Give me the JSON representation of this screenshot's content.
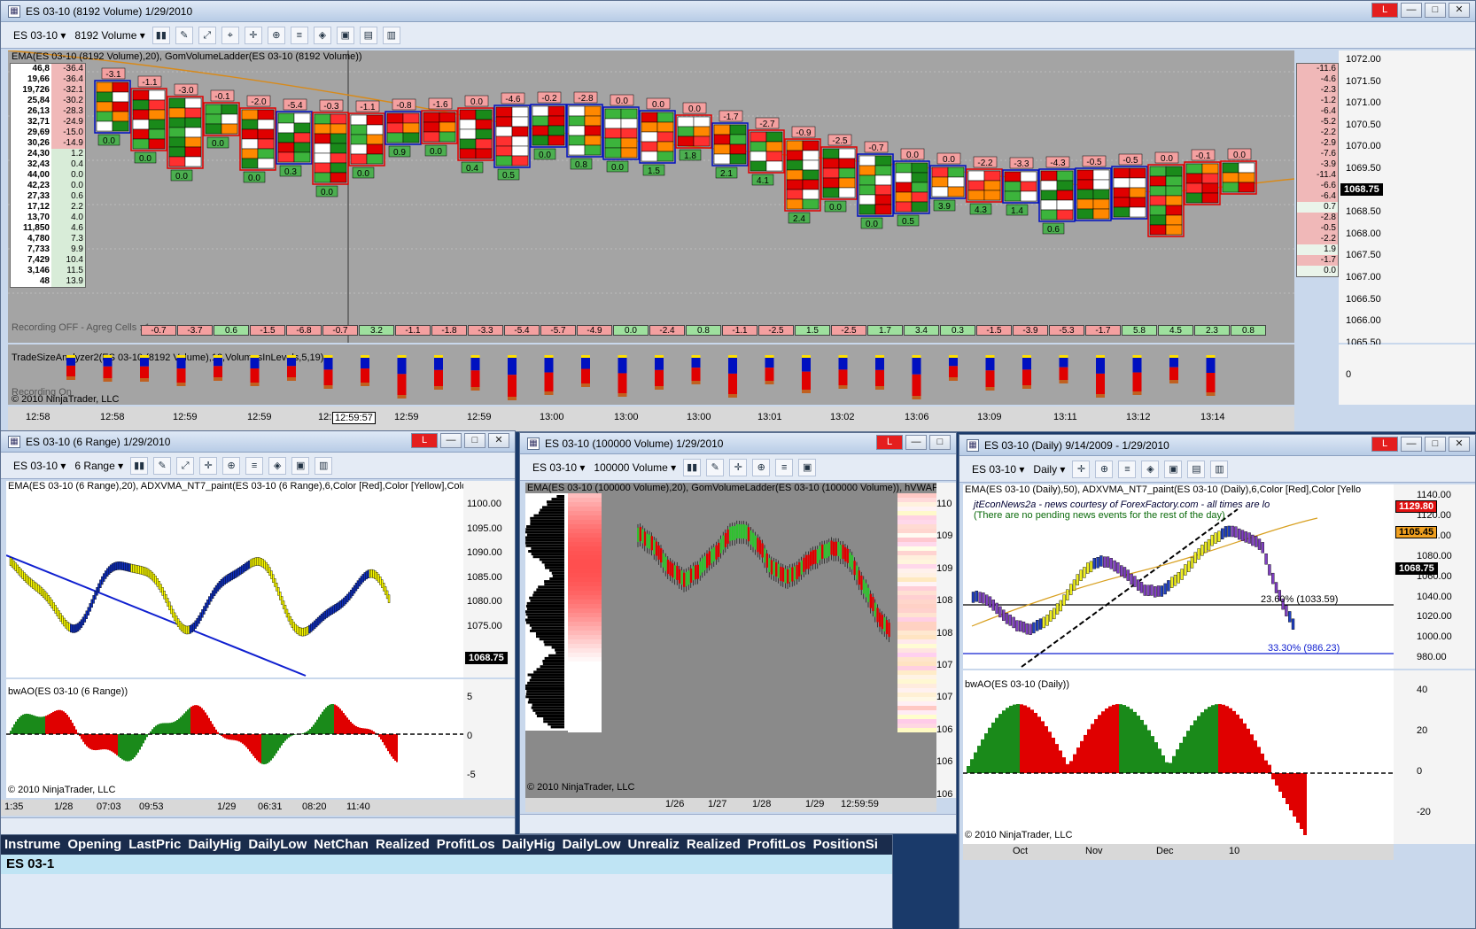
{
  "main": {
    "title": "ES 03-10 (8192 Volume)  1/29/2010",
    "instrument": "ES 03-10",
    "period": "8192 Volume",
    "indicator_caption": "EMA(ES 03-10 (8192 Volume),20), GomVolumeLadder(ES 03-10 (8192 Volume))",
    "recording_caption": "Recording OFF - Agreg Cells : 1",
    "tsa_caption": "TradeSizeAnalyzer2(ES 03-10 (8192 Volume),12,VolumesInLevels,5,19)",
    "recording_on": "Recording On",
    "copyright": "© 2010 NinjaTrader, LLC",
    "price_axis": [
      "1072.00",
      "1071.50",
      "1071.00",
      "1070.50",
      "1070.00",
      "1069.50",
      "1069.00",
      "1068.50",
      "1068.00",
      "1067.50",
      "1067.00",
      "1066.50",
      "1066.00",
      "1065.50"
    ],
    "current_price": "1068.75",
    "zero_label": "0",
    "time_axis": [
      "12:58",
      "12:58",
      "12:59",
      "12:59",
      "12:",
      "12:59:57",
      "12:59",
      "12:59",
      "13:00",
      "13:00",
      "13:00",
      "13:01",
      "13:02",
      "13:06",
      "13:09",
      "13:11",
      "13:12",
      "13:14"
    ],
    "left_volumes": [
      "46,8",
      "19,66",
      "19,726",
      "25,84",
      "26,13",
      "32,71",
      "29,69",
      "30,26",
      "24,30",
      "32,43",
      "44,00",
      "42,23",
      "27,33",
      "17,12",
      "13,70",
      "11,850",
      "4,780",
      "7,733",
      "7,429",
      "3,146",
      "48"
    ],
    "left_deltas": [
      "-36.4",
      "-36.4",
      "-32.1",
      "-30.2",
      "-28.3",
      "-24.9",
      "-15.0",
      "-14.9",
      "1.2",
      "0.4",
      "0.0",
      "0.0",
      "0.6",
      "2.2",
      "4.0",
      "4.6",
      "7.3",
      "9.9",
      "10.4",
      "11.5",
      "13.9"
    ],
    "right_deltas": [
      "-11.6",
      "-4.6",
      "-2.3",
      "-1.2",
      "-6.4",
      "-5.2",
      "-2.2",
      "-2.9",
      "-7.6",
      "-3.9",
      "-11.4",
      "-6.6",
      "-6.4",
      "0.7",
      "-2.8",
      "-0.5",
      "-2.2",
      "1.9",
      "-1.7",
      "0.0"
    ],
    "bottom_deltas": [
      "-0.7",
      "-3.7",
      "0.6",
      "-1.5",
      "-6.8",
      "-0.7",
      "3.2",
      "-1.1",
      "-1.8",
      "-3.3",
      "-5.4",
      "-5.7",
      "-4.9",
      "0.0",
      "-2.4",
      "0.8",
      "-1.1",
      "-2.5",
      "1.5",
      "-2.5",
      "1.7",
      "3.4",
      "0.3",
      "-1.5",
      "-3.9",
      "-5.3",
      "-1.7",
      "5.8",
      "4.5",
      "2.3",
      "0.8"
    ],
    "bar_deltas": [
      "-3.1",
      "-1.1",
      "-3.0",
      "-0.1",
      "-2.0",
      "-5.4",
      "-0.3",
      "-1.1",
      "-0.8",
      "-1.6",
      "0.0",
      "-4.6",
      "-0.2",
      "-2.8",
      "0.0",
      "0.0",
      "0.0",
      "-1.7",
      "-2.7",
      "-0.9",
      "-2.5",
      "-0.7",
      "0.0",
      "0.0",
      "-2.2",
      "-3.3",
      "-4.3",
      "-0.5",
      "-0.5",
      "0.0",
      "-0.1",
      "0.0"
    ],
    "bar_totals": [
      "0.0",
      "0.0",
      "0.0",
      "0.0",
      "0.0",
      "0.3",
      "0.0",
      "0.0",
      "0.9",
      "0.0",
      "0.4",
      "0.5",
      "0.0",
      "0.8",
      "0.0",
      "1.5",
      "1.8",
      "2.1",
      "4.1",
      "2.4",
      "0.0",
      "0.0",
      "0.5",
      "3.9",
      "4.3",
      "1.4",
      "0.6"
    ]
  },
  "range_win": {
    "title": "ES 03-10 (6 Range)  1/29/2010",
    "instrument": "ES 03-10",
    "period": "6 Range",
    "caption": "EMA(ES 03-10 (6 Range),20), ADXVMA_NT7_paint(ES 03-10 (6 Range),6,Color [Red],Color [Yellow],Color [Co",
    "ao_caption": "bwAO(ES 03-10 (6 Range))",
    "copyright": "© 2010 NinjaTrader, LLC",
    "price_axis": [
      "1100.00",
      "1095.00",
      "1090.00",
      "1085.00",
      "1080.00",
      "1075.00"
    ],
    "current_price": "1068.75",
    "ao_axis": [
      "5",
      "0",
      "-5"
    ],
    "time_axis": [
      "1:35",
      "1/28",
      "07:03",
      "09:53",
      "1/29",
      "06:31",
      "08:20",
      "11:40"
    ]
  },
  "vol_win": {
    "title": "ES 03-10 (100000 Volume)  1/29/2010",
    "instrument": "ES 03-10",
    "period": "100000 Volume",
    "caption": "EMA(ES 03-10 (100000 Volume),20), GomVolumeLadder(ES 03-10 (100000 Volume)), hVWAP(ES0",
    "copyright": "© 2010 NinjaTrader, LLC",
    "price_axis": [
      "110",
      "109",
      "109",
      "108",
      "108",
      "107",
      "107",
      "106",
      "106",
      "106"
    ],
    "time_axis": [
      "1/26",
      "1/27",
      "1/28",
      "1/29",
      "12:59:59"
    ]
  },
  "daily_win": {
    "title": "ES 03-10 (Daily)  9/14/2009 - 1/29/2010",
    "instrument": "ES 03-10",
    "period": "Daily",
    "caption": "EMA(ES 03-10 (Daily),50), ADXVMA_NT7_paint(ES 03-10 (Daily),6,Color [Red],Color [Yello",
    "news1": "jtEconNews2a - news courtesy of ForexFactory.com - all times are lo",
    "news2": "(There are no pending news events for the rest of the day)",
    "fib1": "23.60% (1033.59)",
    "fib2": "33.30% (986.23)",
    "ao_caption": "bwAO(ES 03-10 (Daily))",
    "copyright": "© 2010 NinjaTrader, LLC",
    "price_axis": [
      "1140.00",
      "1120.00",
      "1100.00",
      "1080.00",
      "1060.00",
      "1040.00",
      "1020.00",
      "1000.00",
      "980.00"
    ],
    "tag_top": "1129.80",
    "tag_mid": "1105.45",
    "current_price": "1068.75",
    "ao_axis": [
      "40",
      "20",
      "0",
      "-20"
    ],
    "time_axis": [
      "Oct",
      "Nov",
      "Dec",
      "10"
    ]
  },
  "grid": {
    "headers": [
      "Instrume",
      "Opening",
      "LastPric",
      "DailyHig",
      "DailyLow",
      "NetChan",
      "Realized",
      "ProfitLos",
      "DailyHig",
      "DailyLow",
      "Unrealiz",
      "Realized",
      "ProfitLos",
      "PositionSi"
    ],
    "row": "ES 03-1"
  },
  "colors": {
    "bull": "#1a8a1a",
    "bear": "#e00000",
    "adx_up": "#1030c0",
    "adx_flat": "#ffff00"
  }
}
